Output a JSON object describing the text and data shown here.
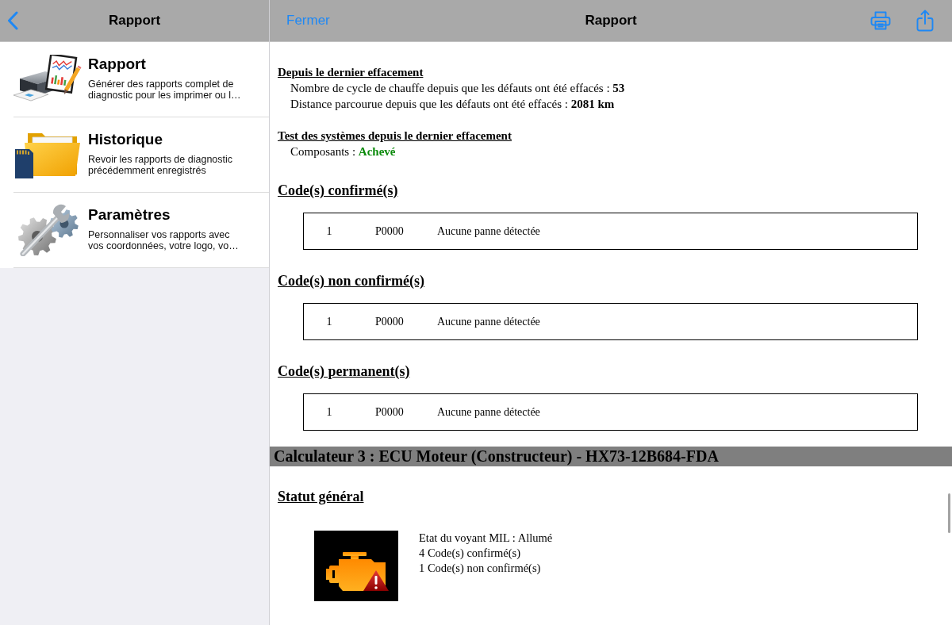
{
  "sidebar": {
    "nav_bar": {
      "title": "Rapport"
    },
    "items": [
      {
        "title": "Rapport",
        "description": "Générer des rapports complet de diagnostic pour les imprimer ou l…"
      },
      {
        "title": "Historique",
        "description": "Revoir les rapports de diagnostic précédemment enregistrés"
      },
      {
        "title": "Paramètres",
        "description": "Personnaliser vos rapports avec vos coordonnées, votre logo, vo…"
      }
    ]
  },
  "report": {
    "nav_bar": {
      "close_button": "Fermer",
      "title": "Rapport"
    },
    "sections": [
      {
        "kind": "info",
        "heading": "Depuis le dernier effacement",
        "lines": [
          {
            "label": "Nombre de cycle de chauffe depuis que les défauts ont été effacés :",
            "value": "53"
          },
          {
            "label": "Distance parcourue depuis que les défauts ont été effacés :",
            "value": "2081 km"
          }
        ]
      },
      {
        "kind": "info",
        "heading": "Test des systèmes depuis le dernier effacement",
        "lines": [
          {
            "label": "Composants :",
            "value": "Achevé",
            "complete": true
          }
        ]
      },
      {
        "kind": "codes",
        "heading": "Code(s) confirmé(s)",
        "rows": [
          {
            "number": "1",
            "code": "P0000",
            "description": "Aucune panne détectée"
          }
        ]
      },
      {
        "kind": "codes",
        "heading": "Code(s) non confirmé(s)",
        "rows": [
          {
            "number": "1",
            "code": "P0000",
            "description": "Aucune panne détectée"
          }
        ]
      },
      {
        "kind": "codes",
        "heading": "Code(s) permanent(s)",
        "rows": [
          {
            "number": "1",
            "code": "P0000",
            "description": "Aucune panne détectée"
          }
        ]
      },
      {
        "kind": "banner",
        "title": "Calculateur 3 : ECU Moteur (Constructeur) - HX73-12B684-FDA"
      },
      {
        "kind": "status",
        "heading": "Statut général",
        "lines": [
          "Etat du voyant MIL : Allumé",
          "4 Code(s) confirmé(s)",
          "1 Code(s) non confirmé(s)"
        ]
      }
    ]
  }
}
